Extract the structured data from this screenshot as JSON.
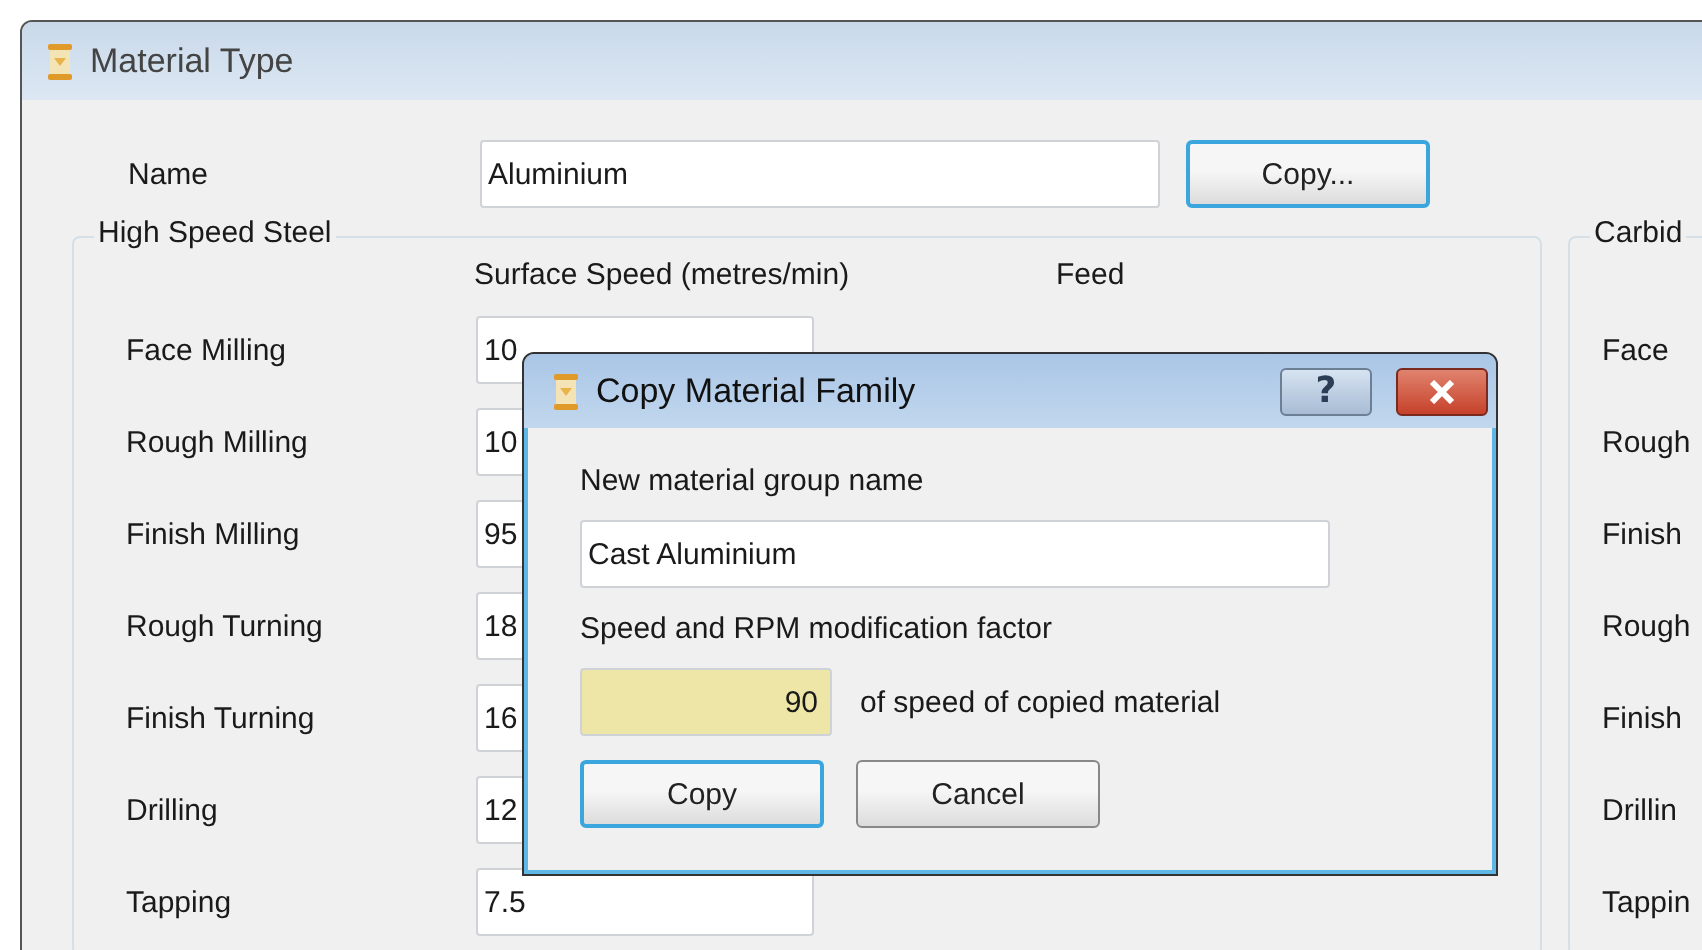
{
  "window": {
    "title": "Material Type"
  },
  "name_field": {
    "label": "Name",
    "value": "Aluminium"
  },
  "copy_button": {
    "label": "Copy...",
    "default": true
  },
  "groups": [
    {
      "title": "High Speed Steel",
      "columns": [
        "Surface Speed (metres/min)",
        "Feed"
      ],
      "rows": [
        {
          "label": "Face Milling",
          "speed": "10"
        },
        {
          "label": "Rough Milling",
          "speed": "10"
        },
        {
          "label": "Finish Milling",
          "speed": "95"
        },
        {
          "label": "Rough Turning",
          "speed": "18"
        },
        {
          "label": "Finish Turning",
          "speed": "16"
        },
        {
          "label": "Drilling",
          "speed": "12"
        },
        {
          "label": "Tapping",
          "speed": "7.5"
        }
      ]
    },
    {
      "title": "Carbid",
      "rows": [
        {
          "label": "Face"
        },
        {
          "label": "Rough"
        },
        {
          "label": "Finish"
        },
        {
          "label": "Rough"
        },
        {
          "label": "Finish"
        },
        {
          "label": "Drillin"
        },
        {
          "label": "Tappin"
        }
      ]
    }
  ],
  "dialog": {
    "title": "Copy Material Family",
    "help": "?",
    "name_label": "New material group name",
    "name_value": "Cast Aluminium",
    "factor_label": "Speed and RPM modification factor",
    "factor_value": "90",
    "factor_suffix": "of speed of copied material",
    "buttons": [
      {
        "label": "Copy",
        "default": true
      },
      {
        "label": "Cancel",
        "default": false
      }
    ]
  }
}
